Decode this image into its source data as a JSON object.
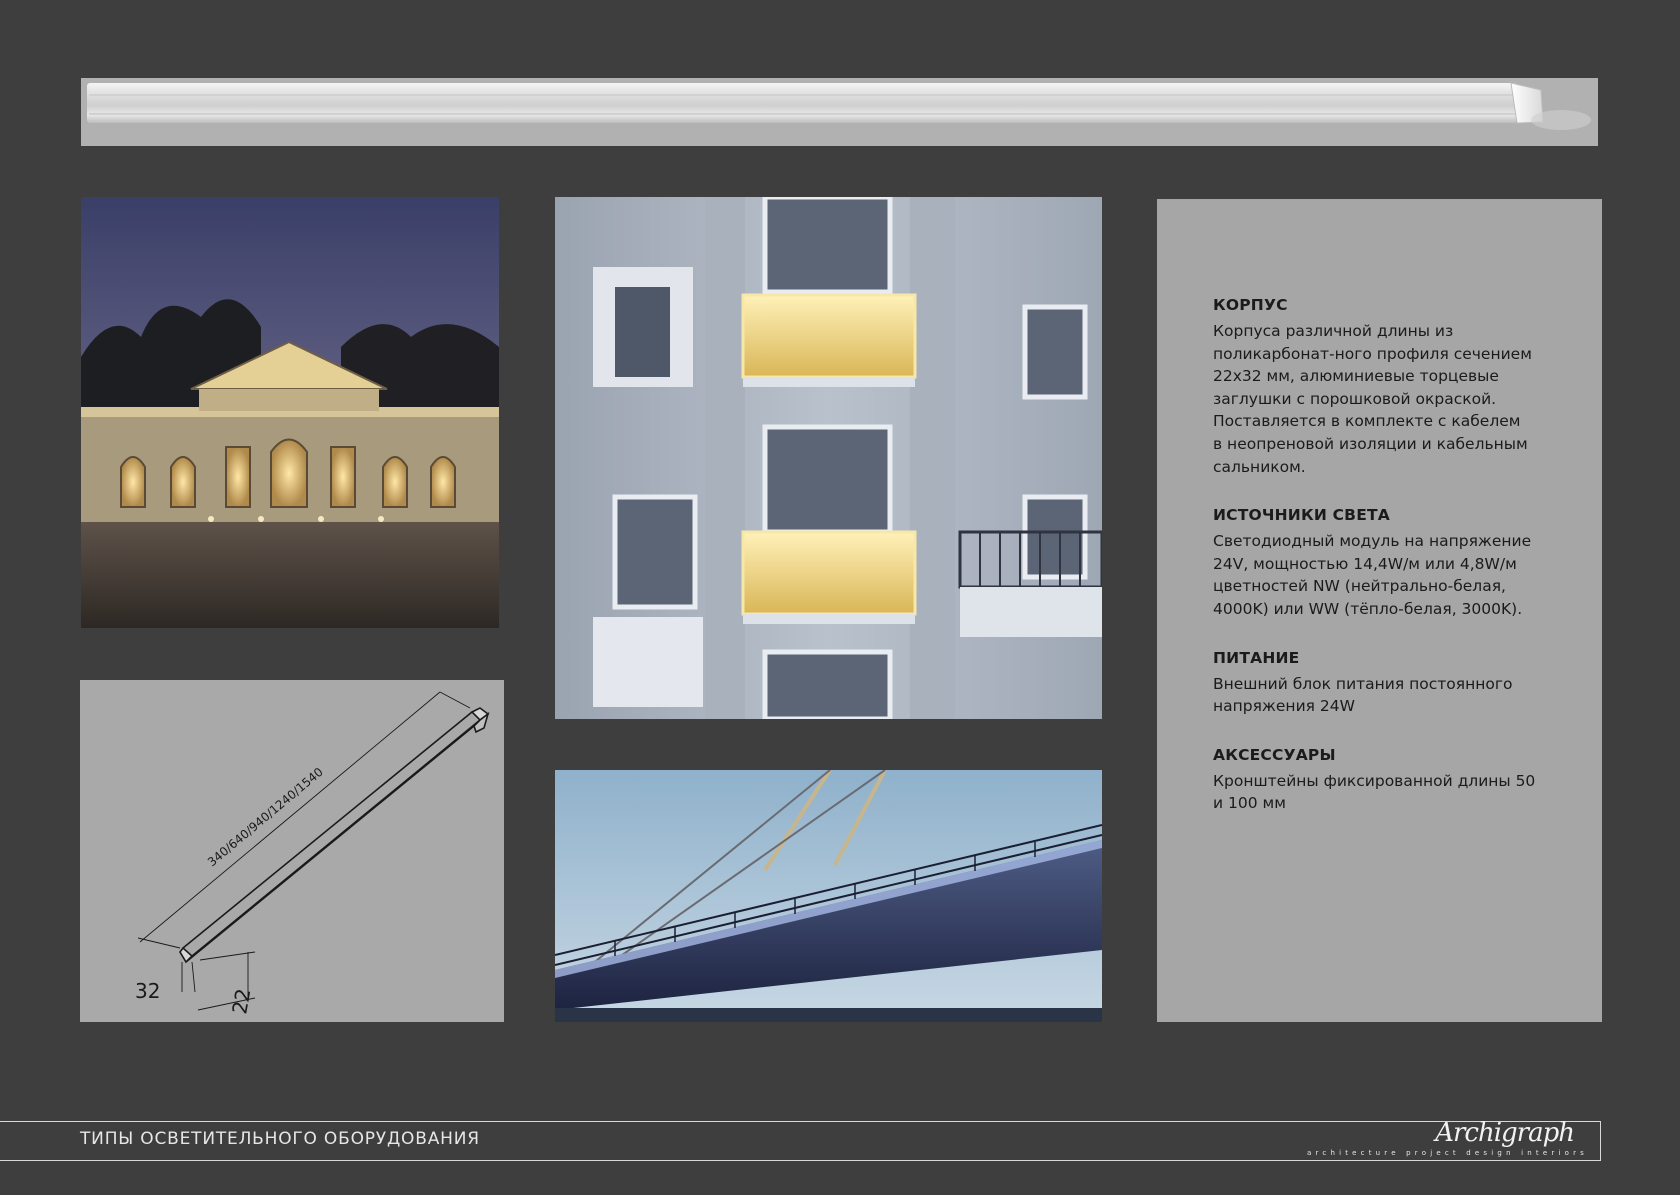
{
  "spec": {
    "sections": [
      {
        "heading": "КОРПУС",
        "text": "Корпуса различной длины из\nполикарбонат-ного профиля сечением\n22х32 мм, алюминиевые торцевые\nзаглушки с порошковой окраской.\nПоставляется в комплекте с кабелем\nв неопреновой изоляции и кабельным\nсальником."
      },
      {
        "heading": "ИСТОЧНИКИ СВЕТА",
        "text": "Светодиодный модуль на напряжение\n24V, мощностью 14,4W/м или 4,8W/м\nцветностей NW (нейтрально-белая,\n4000K) или WW (тёпло-белая, 3000K)."
      },
      {
        "heading": "ПИТАНИЕ",
        "text": "Внешний блок питания постоянного\nнапряжения 24W"
      },
      {
        "heading": "АКСЕССУАРЫ",
        "text": "Кронштейны фиксированной длины 50\nи 100 мм"
      }
    ]
  },
  "drawing": {
    "length_label": "340/640/940/1240/1540",
    "width_label": "32",
    "height_label": "22"
  },
  "footer": {
    "title": "ТИПЫ ОСВЕТИТЕЛЬНОГО ОБОРУДОВАНИЯ",
    "logo_script": "Archigraph",
    "logo_tagline": "architecture project design interiors"
  },
  "colors": {
    "page_background": "#3e3e3e",
    "panel_gray": "#a6a6a6",
    "warm_light": "#f4d98a"
  }
}
